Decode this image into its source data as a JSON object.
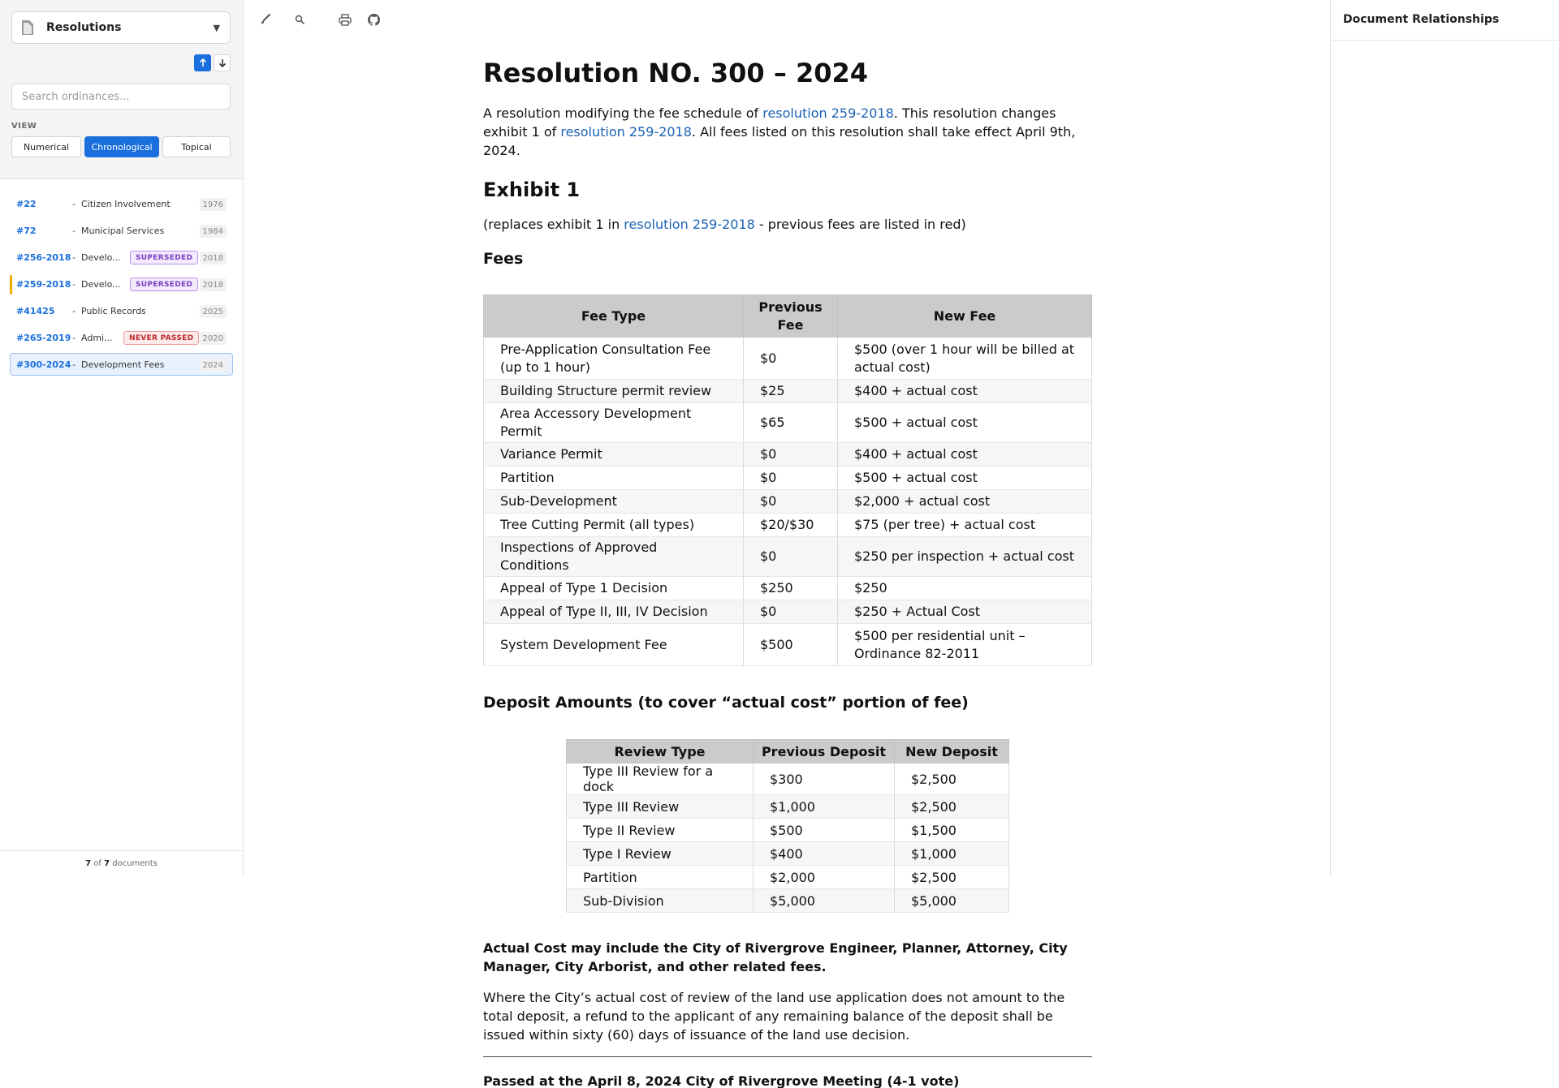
{
  "sidebar": {
    "collection_label": "Resolutions",
    "search_placeholder": "Search ordinances...",
    "view_label": "VIEW",
    "views": [
      "Numerical",
      "Chronological",
      "Topical"
    ],
    "active_view": "Chronological",
    "documents": [
      {
        "number": "#22",
        "title": "Citizen Involvement",
        "badge": "",
        "year": "1976"
      },
      {
        "number": "#72",
        "title": "Municipal Services",
        "badge": "",
        "year": "1984"
      },
      {
        "number": "#256-2018",
        "title": "Develo...",
        "badge": "SUPERSEDED",
        "year": "2018"
      },
      {
        "number": "#259-2018",
        "title": "Develo...",
        "badge": "SUPERSEDED",
        "year": "2018"
      },
      {
        "number": "#41425",
        "title": "Public Records",
        "badge": "",
        "year": "2025"
      },
      {
        "number": "#265-2019",
        "title": "Admi...",
        "badge": "NEVER PASSED",
        "year": "2020"
      },
      {
        "number": "#300-2024",
        "title": "Development Fees",
        "badge": "",
        "year": "2024"
      }
    ],
    "count_shown": "7",
    "count_of": "of",
    "count_total": "7",
    "count_suffix": "documents"
  },
  "right_panel": {
    "title": "Document Relationships"
  },
  "document": {
    "title": "Resolution NO. 300 – 2024",
    "intro": {
      "p1": "A resolution modifying the fee schedule of ",
      "link1": "resolution 259-2018",
      "p2": ". This resolution changes exhibit 1 of ",
      "link2": "resolution 259-2018",
      "p3": ". All fees listed on this resolution shall take effect April 9th, 2024."
    },
    "exhibit_heading": "Exhibit 1",
    "replaces": {
      "p1": "(replaces exhibit 1 in ",
      "link": "resolution 259-2018",
      "p2": " - previous fees are listed in red)"
    },
    "fees_heading": "Fees",
    "fees_table": {
      "headers": [
        "Fee Type",
        "Previous Fee",
        "New Fee"
      ],
      "rows": [
        [
          "Pre-Application Consultation Fee (up to 1 hour)",
          "$0",
          "$500 (over 1 hour will be billed at actual cost)"
        ],
        [
          "Building Structure permit review",
          "$25",
          "$400 + actual cost"
        ],
        [
          "Area Accessory Development Permit",
          "$65",
          "$500 + actual cost"
        ],
        [
          "Variance Permit",
          "$0",
          "$400 + actual cost"
        ],
        [
          "Partition",
          "$0",
          "$500 + actual cost"
        ],
        [
          "Sub-Development",
          "$0",
          "$2,000 + actual cost"
        ],
        [
          "Tree Cutting Permit (all types)",
          "$20/$30",
          "$75 (per tree) + actual cost"
        ],
        [
          "Inspections of Approved Conditions",
          "$0",
          "$250 per inspection + actual cost"
        ],
        [
          "Appeal of Type 1 Decision",
          "$250",
          "$250"
        ],
        [
          "Appeal of Type II, III, IV Decision",
          "$0",
          "$250 + Actual Cost"
        ],
        [
          "System Development Fee",
          "$500",
          "$500 per residential unit – Ordinance 82-2011"
        ]
      ]
    },
    "deposit_heading": "Deposit Amounts (to cover “actual cost” portion of fee)",
    "deposit_table": {
      "headers": [
        "Review Type",
        "Previous Deposit",
        "New Deposit"
      ],
      "rows": [
        [
          "Type III Review for a dock",
          "$300",
          "$2,500"
        ],
        [
          "Type III Review",
          "$1,000",
          "$2,500"
        ],
        [
          "Type II Review",
          "$500",
          "$1,500"
        ],
        [
          "Type I Review",
          "$400",
          "$1,000"
        ],
        [
          "Partition",
          "$2,000",
          "$2,500"
        ],
        [
          "Sub-Division",
          "$5,000",
          "$5,000"
        ]
      ]
    },
    "actual_cost_note": "Actual Cost may include the City of Rivergrove Engineer, Planner, Attorney, City Manager, City Arborist, and other related fees.",
    "refund_note": "Where the City’s actual cost of review of the land use application does not amount to the total deposit, a refund to the applicant of any remaining balance of the deposit shall be issued within sixty (60) days of issuance of the land use decision.",
    "passed_note": "Passed at the April 8, 2024 City of Rivergrove Meeting (4-1 vote)"
  },
  "toolbar": {
    "icons": [
      "brush-icon",
      "search-icon",
      "print-icon",
      "github-icon"
    ]
  },
  "colors": {
    "accent": "#1a6fdc",
    "link": "#1a62b5",
    "superseded": "#7a3fc4",
    "never_passed": "#c02b2b",
    "marker": "#f2a900"
  }
}
